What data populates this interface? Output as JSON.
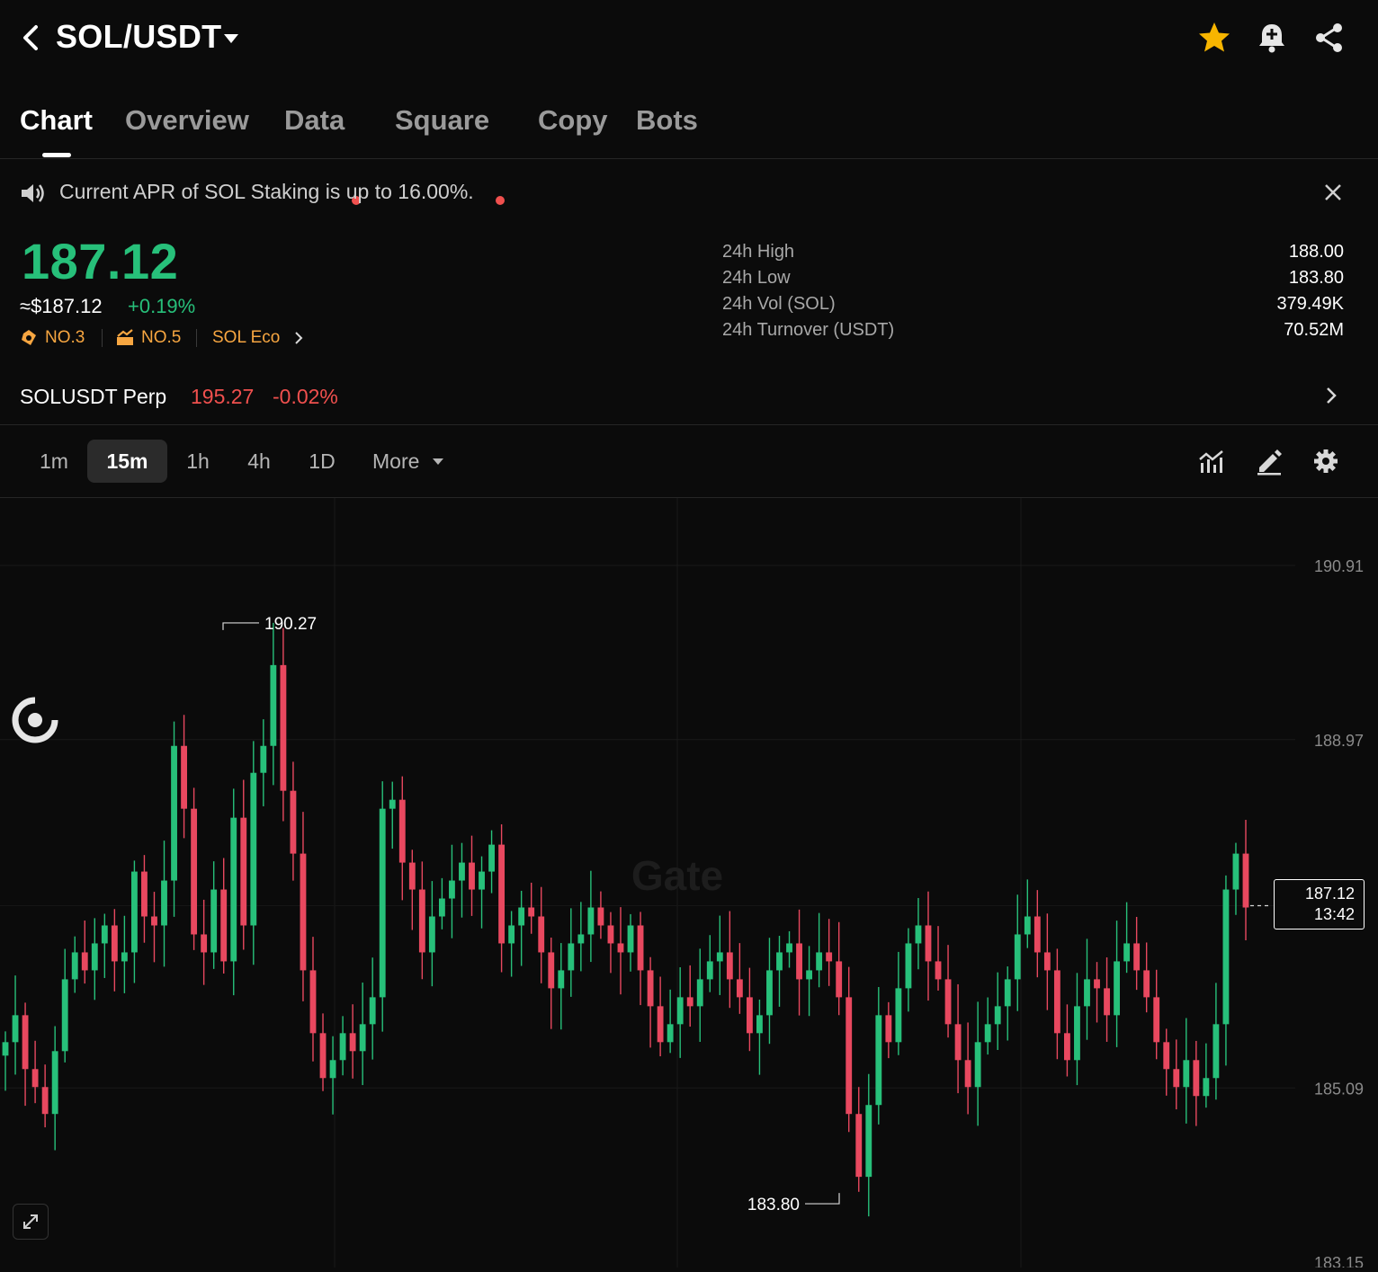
{
  "header": {
    "pair": "SOL/USDT",
    "icons": [
      "back-icon",
      "caret-down-icon",
      "star-icon",
      "bell-plus-icon",
      "share-icon"
    ],
    "star_color": "#f7b500"
  },
  "tabs": [
    {
      "label": "Chart",
      "active": true,
      "dot": false
    },
    {
      "label": "Overview",
      "active": false,
      "dot": false
    },
    {
      "label": "Data",
      "active": false,
      "dot": true
    },
    {
      "label": "Square",
      "active": false,
      "dot": true
    },
    {
      "label": "Copy",
      "active": false,
      "dot": false
    },
    {
      "label": "Bots",
      "active": false,
      "dot": false
    }
  ],
  "notice": {
    "text": "Current APR of SOL Staking is up to 16.00%."
  },
  "ticker": {
    "last_price": "187.12",
    "usd_price": "≈$187.12",
    "change_pct": "+0.19%",
    "ranks": [
      {
        "icon": "hot-tag-icon",
        "label": "NO.3"
      },
      {
        "icon": "rise-icon",
        "label": "NO.5"
      }
    ],
    "eco_label": "SOL Eco",
    "stats": [
      {
        "label": "24h High",
        "value": "188.00"
      },
      {
        "label": "24h Low",
        "value": "183.80"
      },
      {
        "label": "24h Vol (SOL)",
        "value": "379.49K"
      },
      {
        "label": "24h Turnover (USDT)",
        "value": "70.52M"
      }
    ]
  },
  "perp": {
    "name": "SOLUSDT Perp",
    "price": "195.27",
    "change": "-0.02%"
  },
  "intervals": [
    {
      "label": "1m",
      "active": false
    },
    {
      "label": "15m",
      "active": true
    },
    {
      "label": "1h",
      "active": false
    },
    {
      "label": "4h",
      "active": false
    },
    {
      "label": "1D",
      "active": false
    },
    {
      "label": "More",
      "active": false
    }
  ],
  "chart_tools": [
    "indicators-icon",
    "draw-pencil-icon",
    "settings-gear-icon"
  ],
  "chart": {
    "watermark": "Gate",
    "y_ticks": [
      "190.91",
      "188.97",
      "185.09",
      "183.15"
    ],
    "high_marker": "190.27",
    "low_marker": "183.80",
    "current_price": "187.12",
    "countdown": "13:42",
    "up_color": "#27c07a",
    "down_color": "#e8485f"
  },
  "chart_data": {
    "type": "candlestick",
    "interval": "15m",
    "y_range": [
      183.15,
      191.2
    ],
    "y_ticks": [
      190.91,
      188.97,
      185.09,
      183.15
    ],
    "annotations": [
      {
        "label": "190.27",
        "value": 190.27,
        "type": "high"
      },
      {
        "label": "183.80",
        "value": 183.8,
        "type": "low"
      },
      {
        "label": "187.12",
        "value": 187.12,
        "type": "last"
      }
    ],
    "closes": [
      185.6,
      185.9,
      185.3,
      185.1,
      184.8,
      185.5,
      186.3,
      186.6,
      186.4,
      186.7,
      186.9,
      186.5,
      186.6,
      187.5,
      187.0,
      186.9,
      187.4,
      188.9,
      188.2,
      186.8,
      186.6,
      187.3,
      186.5,
      188.1,
      186.9,
      188.6,
      188.9,
      189.8,
      188.4,
      187.7,
      186.4,
      185.7,
      185.2,
      185.4,
      185.7,
      185.5,
      185.8,
      186.1,
      188.2,
      188.3,
      187.6,
      187.3,
      186.6,
      187.0,
      187.2,
      187.4,
      187.6,
      187.3,
      187.5,
      187.8,
      186.7,
      186.9,
      187.1,
      187.0,
      186.6,
      186.2,
      186.4,
      186.7,
      186.8,
      187.1,
      186.9,
      186.7,
      186.6,
      186.9,
      186.4,
      186.0,
      185.6,
      185.8,
      186.1,
      186.0,
      186.3,
      186.5,
      186.6,
      186.3,
      186.1,
      185.7,
      185.9,
      186.4,
      186.6,
      186.7,
      186.3,
      186.4,
      186.6,
      186.5,
      186.1,
      184.8,
      184.1,
      184.9,
      185.9,
      185.6,
      186.2,
      186.7,
      186.9,
      186.5,
      186.3,
      185.8,
      185.4,
      185.1,
      185.6,
      185.8,
      186.0,
      186.3,
      186.8,
      187.0,
      186.6,
      186.4,
      185.7,
      185.4,
      186.0,
      186.3,
      186.2,
      185.9,
      186.5,
      186.7,
      186.4,
      186.1,
      185.6,
      185.3,
      185.1,
      185.4,
      185.0,
      185.2,
      185.8,
      187.3,
      187.7,
      187.1
    ]
  }
}
